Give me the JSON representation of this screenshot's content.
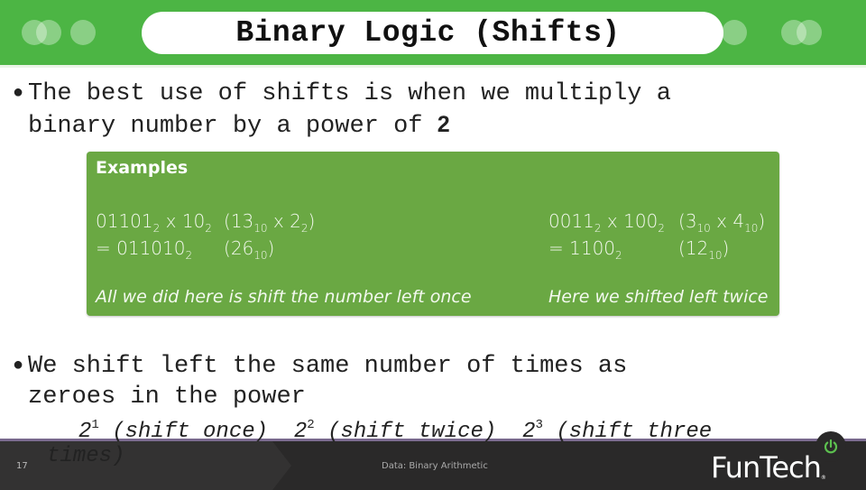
{
  "header": {
    "title": "Binary Logic (Shifts)"
  },
  "bullets": [
    {
      "line1": "The best use of shifts is when we multiply a",
      "line2_prefix": "binary number by a power of ",
      "line2_bold": "2"
    },
    {
      "line1": "We shift left the same number of times as",
      "line2": "zeroes in the power"
    }
  ],
  "examples": {
    "title": "Examples",
    "left": {
      "line1": {
        "a": "01101",
        "a_base": "2",
        "op": " x ",
        "b": "10",
        "b_base": "2",
        "paren_open": "(",
        "c": "13",
        "c_base": "10",
        "op2": " x ",
        "d": "2",
        "d_base": "2",
        "paren_close": ")"
      },
      "line2": {
        "prefix": "= ",
        "result": "011010",
        "result_base": "2",
        "paren_open": "(",
        "dec": "26",
        "dec_base": "10",
        "paren_close": ")"
      },
      "note": "All we did here is shift the number left once"
    },
    "right": {
      "line1": {
        "a": "0011",
        "a_base": "2",
        "op": " x ",
        "b": "100",
        "b_base": "2",
        "paren_open": "(",
        "c": "3",
        "c_base": "10",
        "op2": " x ",
        "d": "4",
        "d_base": "10",
        "paren_close": ")"
      },
      "line2": {
        "prefix": "= ",
        "result": "1100",
        "result_base": "2",
        "paren_open": "(",
        "dec": "12",
        "dec_base": "10",
        "paren_close": ")"
      },
      "note": "Here we shifted left twice"
    }
  },
  "powers_line": {
    "p1_base": "2",
    "p1_exp": "1",
    "p1_text": " (shift once)  ",
    "p2_base": "2",
    "p2_exp": "2",
    "p2_text": " (shift twice)  ",
    "p3_base": "2",
    "p3_exp": "3",
    "p3_text": " (shift three",
    "overflow": "times)"
  },
  "footer": {
    "page_number": "17",
    "title": "Data: Binary Arithmetic",
    "logo": "FunTech",
    "logo_mark": "®"
  },
  "colors": {
    "header_green": "#4cb544",
    "examples_green": "#6aa843",
    "footer_dark": "#333232",
    "footer_accent": "#7a6a8e",
    "power_icon_green": "#5cc04f"
  }
}
